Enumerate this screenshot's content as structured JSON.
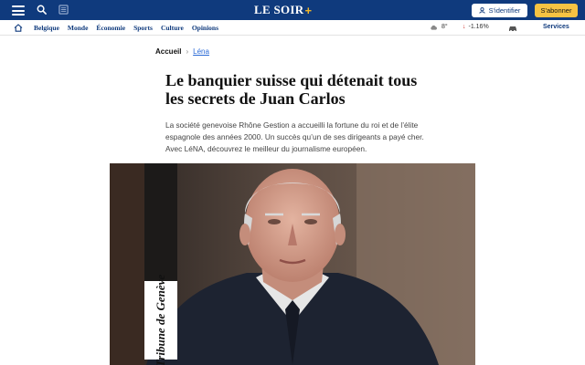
{
  "header": {
    "logo": "LE SOIR",
    "logo_plus": "+",
    "login_label": "S'identifier",
    "subscribe_label": "S'abonner",
    "icons": [
      "menu-icon",
      "search-icon",
      "newspaper-icon",
      "user-icon"
    ],
    "colors": {
      "brand": "#0f3a7d",
      "accent": "#f6c343"
    }
  },
  "nav": {
    "items": [
      "Belgique",
      "Monde",
      "Économie",
      "Sports",
      "Culture",
      "Opinions"
    ],
    "weather_temp": "8°",
    "market_change": "-1.16%",
    "services_label": "Services"
  },
  "article": {
    "breadcrumb_home": "Accueil",
    "breadcrumb_current": "Léna",
    "headline": "Le banquier suisse qui détenait tous les secrets de Juan Carlos",
    "lead": "La société genevoise Rhône Gestion a accueilli la fortune du roi et de l’élite espagnole des années 2000. Un succès qu’un de ses dirigeants a payé cher. Avec LéNA, découvrez le meilleur du journalisme européen.",
    "photo_badge": "Tribune de Genève"
  }
}
